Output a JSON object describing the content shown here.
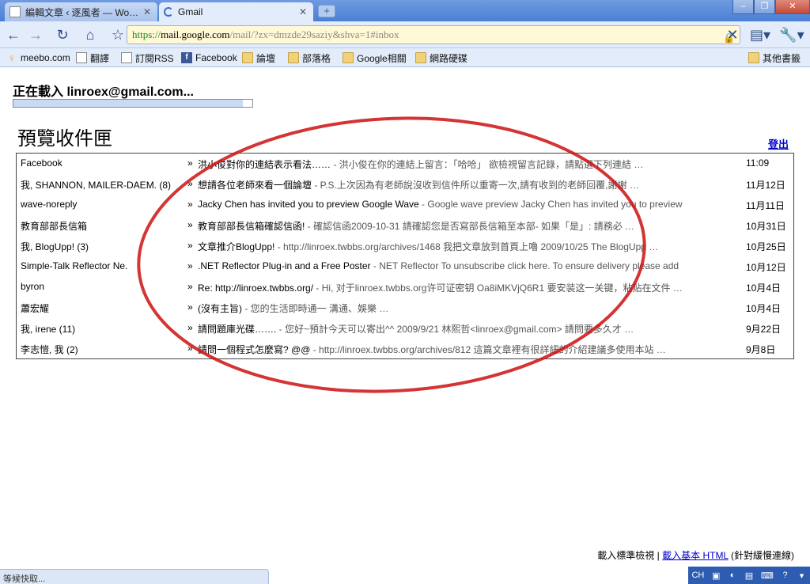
{
  "browser": {
    "tabs": [
      {
        "title": "編輯文章 ‹ 逐風者 — Wo…",
        "active": false
      },
      {
        "title": "Gmail",
        "active": true
      }
    ],
    "url_scheme": "https://",
    "url_host": "mail.google.com",
    "url_path": "/mail/?zx=dmzde29saziy&shva=1#inbox",
    "bookmarks": [
      {
        "label": "meebo.com",
        "icon": "meebo-icon"
      },
      {
        "label": "翻譯",
        "icon": "page-icon"
      },
      {
        "label": "訂閱RSS",
        "icon": "page-icon"
      },
      {
        "label": "Facebook",
        "icon": "facebook-icon"
      },
      {
        "label": "論壇",
        "icon": "folder-icon"
      },
      {
        "label": "部落格",
        "icon": "folder-icon"
      },
      {
        "label": "Google相關",
        "icon": "folder-icon"
      },
      {
        "label": "網路硬碟",
        "icon": "folder-icon"
      }
    ],
    "other_bookmarks": "其他書籤"
  },
  "loading": {
    "text": "正在載入 linroex@gmail.com...",
    "progress": 0.96
  },
  "inbox": {
    "title": "預覽收件匣",
    "signout_label": "登出",
    "rows": [
      {
        "sender": "Facebook",
        "subject": "洪小俊對你的連結表示看法……",
        "snippet": " - 洪小俊在你的連結上留言：「哈哈」 欲檢視留言記錄，請點選下列連結 …",
        "date": "11:09"
      },
      {
        "sender": "我, SHANNON, MAILER-DAEM. (8)",
        "subject": "想請各位老師來看一個論壇",
        "snippet": " - P.S.上次因為有老師說沒收到信件所以重寄一次,請有收到的老師回覆,謝謝 …",
        "date": "11月12日"
      },
      {
        "sender": "wave-noreply",
        "subject": "Jacky Chen has invited you to preview Google Wave",
        "snippet": " - Google wave preview Jacky Chen has invited you to preview",
        "date": "11月11日"
      },
      {
        "sender": "教育部部長信箱",
        "subject": "教育部部長信箱確認信函!",
        "snippet": " - 確認信函2009-10-31 請確認您是否寫部長信箱至本部- 如果「是」: 請務必 …",
        "date": "10月31日"
      },
      {
        "sender": "我, BlogUpp! (3)",
        "subject": "文章推介BlogUpp!",
        "snippet": " - http://linroex.twbbs.org/archives/1468 我把文章放到首頁上嚕 2009/10/25 The BlogUpp …",
        "date": "10月25日"
      },
      {
        "sender": "Simple-Talk Reflector Ne.",
        "subject": ".NET Reflector Plug-in and a Free Poster",
        "snippet": " - NET Reflector To unsubscribe click here. To ensure delivery please add",
        "date": "10月12日"
      },
      {
        "sender": "byron",
        "subject": "Re: http://linroex.twbbs.org/",
        "snippet": " - Hi, 对于linroex.twbbs.org许可证密钥 Oa8iMKVjQ6R1 要安装这一关键，粘贴在文件 …",
        "date": "10月4日"
      },
      {
        "sender": "蕭宏耀",
        "subject": "(沒有主旨)",
        "snippet": " - 您的生活即時通一 溝通、娛樂 …",
        "date": "10月4日"
      },
      {
        "sender": "我, irene (11)",
        "subject": "請問題庫光碟…….",
        "snippet": " - 您好~預計今天可以寄出^^ 2009/9/21 林熙哲<linroex@gmail.com> 請問要多久才 …",
        "date": "9月22日"
      },
      {
        "sender": "李志愷, 我 (2)",
        "subject": "請問一個程式怎麼寫? @@",
        "snippet": " - http://linroex.twbbs.org/archives/812 這篇文章裡有很詳細的介紹建議多使用本站 …",
        "date": "9月8日"
      }
    ]
  },
  "footer": {
    "standard_view": "載入標準檢視",
    "separator": " | ",
    "basic_html": "載入基本 HTML",
    "slow_note": " (針對緩慢連線)"
  },
  "status": {
    "text": "等候快取..."
  },
  "ime": {
    "lang": "CH"
  },
  "colors": {
    "link": "#0000cc",
    "annotation": "#cc1111"
  }
}
